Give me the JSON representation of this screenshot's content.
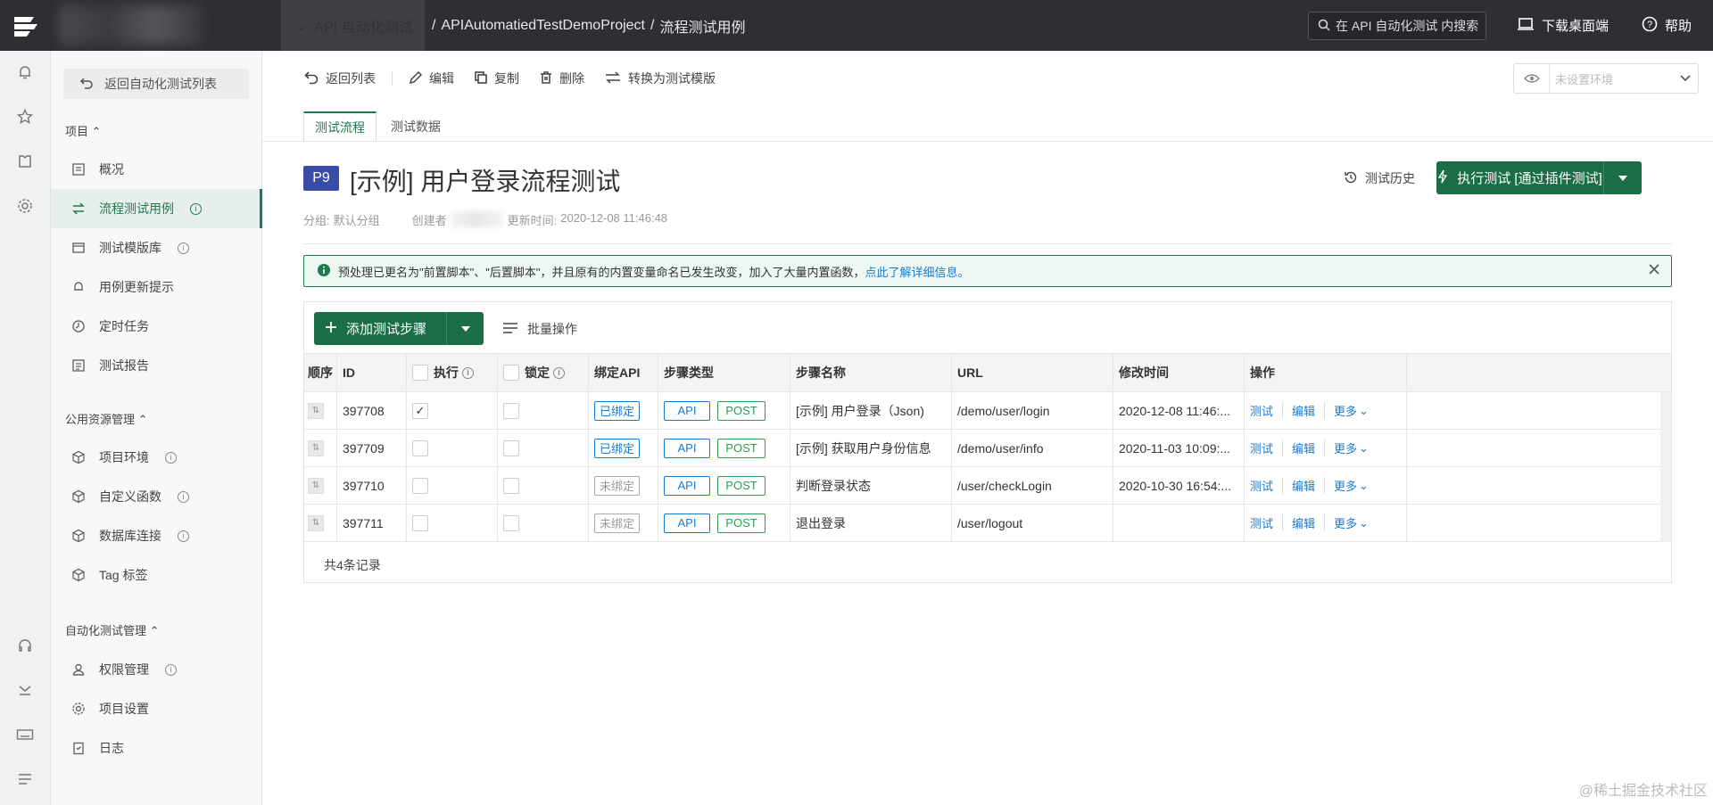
{
  "topbar": {
    "project_switch": "API 自动化测试",
    "breadcrumb": [
      "APIAutomatiedTestDemoProject",
      "流程测试用例"
    ],
    "search_placeholder": "在 API 自动化测试 内搜索",
    "download": "下载桌面端",
    "help": "帮助"
  },
  "sidenav": {
    "back": "返回自动化测试列表",
    "section1": "项目",
    "items1": [
      {
        "label": "概况"
      },
      {
        "label": "流程测试用例"
      },
      {
        "label": "测试模版库"
      },
      {
        "label": "用例更新提示"
      },
      {
        "label": "定时任务"
      },
      {
        "label": "测试报告"
      }
    ],
    "section2": "公用资源管理",
    "items2": [
      {
        "label": "项目环境"
      },
      {
        "label": "自定义函数"
      },
      {
        "label": "数据库连接"
      },
      {
        "label": "Tag 标签"
      }
    ],
    "section3": "自动化测试管理",
    "items3": [
      {
        "label": "权限管理"
      },
      {
        "label": "项目设置"
      },
      {
        "label": "日志"
      }
    ]
  },
  "toolbar": {
    "back": "返回列表",
    "edit": "编辑",
    "copy": "复制",
    "delete": "删除",
    "convert": "转换为测试模版",
    "env_placeholder": "未设置环境"
  },
  "tabs": [
    "测试流程",
    "测试数据"
  ],
  "header": {
    "priority": "P9",
    "title": "[示例] 用户登录流程测试",
    "group_label": "分组:",
    "group_value": "默认分组",
    "creator_label": "创建者",
    "updated_label": "更新时间:",
    "updated_value": "2020-12-08 11:46:48",
    "history": "测试历史",
    "run": "执行测试 [通过插件测试]"
  },
  "notice": {
    "text": "预处理已更名为\"前置脚本\"、\"后置脚本\"，并且原有的内置变量命名已发生改变，加入了大量内置函数，",
    "link": "点此了解详细信息。"
  },
  "steps": {
    "add": "添加测试步骤",
    "batch": "批量操作",
    "columns": [
      "顺序",
      "ID",
      "执行",
      "锁定",
      "绑定API",
      "步骤类型",
      "步骤名称",
      "URL",
      "修改时间",
      "操作"
    ],
    "rows": [
      {
        "id": "397708",
        "exec": true,
        "bind": "已绑定",
        "bound": true,
        "type1": "API",
        "type2": "POST",
        "name": "[示例] 用户登录（Json)",
        "url": "/demo/user/login",
        "time": "2020-12-08 11:46:..."
      },
      {
        "id": "397709",
        "exec": false,
        "bind": "已绑定",
        "bound": true,
        "type1": "API",
        "type2": "POST",
        "name": "[示例] 获取用户身份信息",
        "url": "/demo/user/info",
        "time": "2020-11-03 10:09:..."
      },
      {
        "id": "397710",
        "exec": false,
        "bind": "未绑定",
        "bound": false,
        "type1": "API",
        "type2": "POST",
        "name": "判断登录状态",
        "url": "/user/checkLogin",
        "time": "2020-10-30 16:54:..."
      },
      {
        "id": "397711",
        "exec": false,
        "bind": "未绑定",
        "bound": false,
        "type1": "API",
        "type2": "POST",
        "name": "退出登录",
        "url": "/user/logout",
        "time": ""
      }
    ],
    "ops": [
      "测试",
      "编辑",
      "更多"
    ],
    "total": "共4条记录"
  },
  "watermark": "@稀土掘金技术社区",
  "colors": {
    "primary": "#1a6d46",
    "link": "#1a7ad0",
    "post": "#2e9b51",
    "topbar": "#2e2f32"
  }
}
